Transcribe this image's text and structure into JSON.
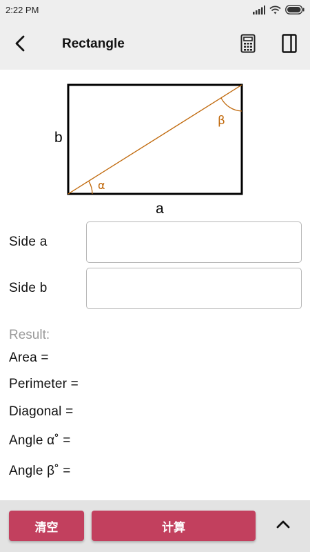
{
  "status_bar": {
    "time": "2:22 PM"
  },
  "app_bar": {
    "title": "Rectangle"
  },
  "figure": {
    "label_a": "a",
    "label_b": "b",
    "angle_alpha": "α",
    "angle_beta": "β"
  },
  "form": {
    "side_a_label": "Side  a",
    "side_a_value": "",
    "side_b_label": "Side  b",
    "side_b_value": ""
  },
  "result": {
    "heading": "Result:",
    "area": "Area =",
    "perimeter": "Perimeter =",
    "diagonal": "Diagonal =",
    "angle_alpha": "Angle  α˚ =",
    "angle_beta": "Angle  β˚ ="
  },
  "buttons": {
    "clear": "清空",
    "calculate": "计算"
  },
  "colors": {
    "accent": "#c2405e",
    "diagonal_line": "#c0680a",
    "bar_background": "#eeeeee",
    "bottom_bar": "#e3e3e3"
  }
}
